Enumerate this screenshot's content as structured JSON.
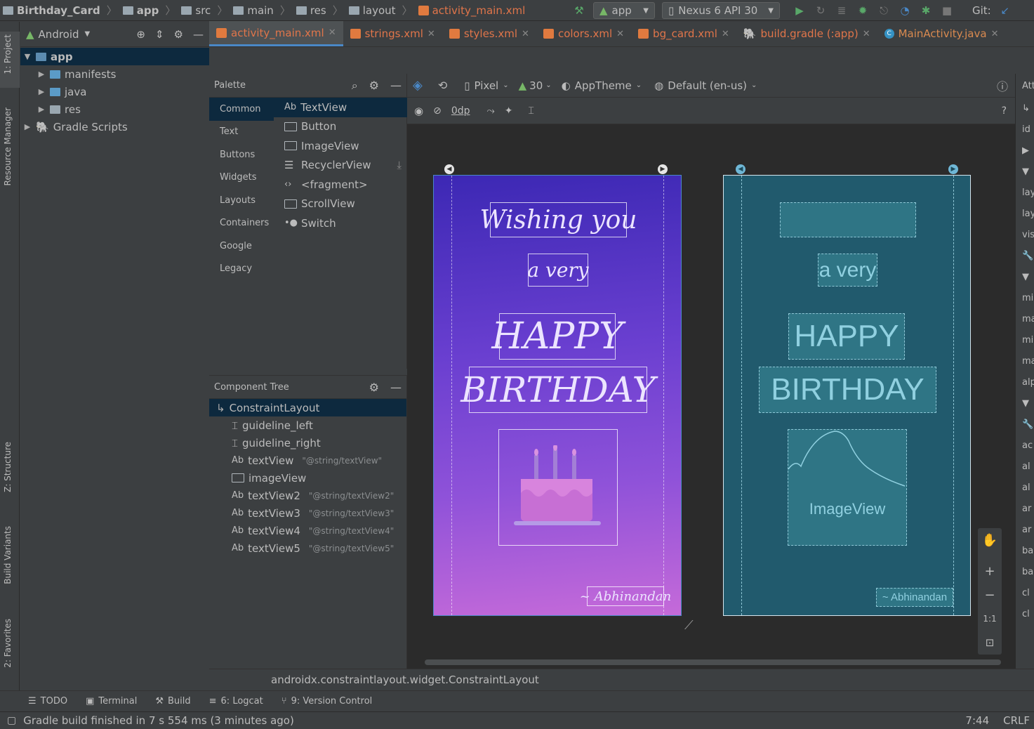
{
  "nav": {
    "crumbs": [
      "Birthday_Card",
      "app",
      "src",
      "main",
      "res",
      "layout",
      "activity_main.xml"
    ],
    "run_config": "app",
    "device": "Nexus 6 API 30",
    "git_label": "Git:"
  },
  "side_tabs": {
    "project": "1: Project",
    "resource_manager": "Resource Manager",
    "structure": "Z: Structure",
    "build_variants": "Build Variants",
    "favorites": "2: Favorites"
  },
  "project": {
    "view_mode": "Android",
    "tree": [
      {
        "label": "app",
        "level": 0,
        "selected": true,
        "expanded": true
      },
      {
        "label": "manifests",
        "level": 1
      },
      {
        "label": "java",
        "level": 1
      },
      {
        "label": "res",
        "level": 1
      },
      {
        "label": "Gradle Scripts",
        "level": 0
      }
    ]
  },
  "tabs": [
    "activity_main.xml",
    "strings.xml",
    "styles.xml",
    "colors.xml",
    "bg_card.xml",
    "build.gradle (:app)",
    "MainActivity.java"
  ],
  "palette": {
    "title": "Palette",
    "categories": [
      "Common",
      "Text",
      "Buttons",
      "Widgets",
      "Layouts",
      "Containers",
      "Google",
      "Legacy"
    ],
    "widgets": [
      "TextView",
      "Button",
      "ImageView",
      "RecyclerView",
      "<fragment>",
      "ScrollView",
      "Switch"
    ],
    "textview_prefix": "Ab"
  },
  "component_tree": {
    "title": "Component Tree",
    "items": [
      {
        "name": "ConstraintLayout",
        "ref": ""
      },
      {
        "name": "guideline_left",
        "ref": ""
      },
      {
        "name": "guideline_right",
        "ref": ""
      },
      {
        "name": "textView",
        "ref": "\"@string/textView\""
      },
      {
        "name": "imageView",
        "ref": ""
      },
      {
        "name": "textView2",
        "ref": "\"@string/textView2\""
      },
      {
        "name": "textView3",
        "ref": "\"@string/textView3\""
      },
      {
        "name": "textView4",
        "ref": "\"@string/textView4\""
      },
      {
        "name": "textView5",
        "ref": "\"@string/textView5\""
      }
    ]
  },
  "design_toolbar": {
    "device": "Pixel",
    "api": "30",
    "theme": "AppTheme",
    "locale": "Default (en-us)",
    "margin": "0dp"
  },
  "design": {
    "line1": "Wishing you",
    "line2": "a very",
    "line3": "HAPPY",
    "line4": "BIRTHDAY",
    "signature": "~ Abhinandan",
    "blueprint_image_label": "ImageView"
  },
  "attributes": {
    "header": "Att",
    "rows": [
      "id",
      "lay",
      "lay",
      "vis",
      "mi",
      "ma",
      "mi",
      "ma",
      "alp",
      "ac",
      "al",
      "al",
      "ar",
      "ar",
      "ba",
      "ba",
      "cl",
      "cl"
    ]
  },
  "zoom": {
    "one_to_one": "1:1"
  },
  "status_path": "androidx.constraintlayout.widget.ConstraintLayout",
  "tool_windows": [
    "TODO",
    "Terminal",
    "Build",
    "6: Logcat",
    "9: Version Control"
  ],
  "statusbar": {
    "message": "Gradle build finished in 7 s 554 ms (3 minutes ago)",
    "position": "7:44",
    "line_sep": "CRLF"
  },
  "colors": {
    "accent": "#4a88c7",
    "xml_tab": "#e0754a",
    "selection": "#0d293e",
    "blueprint": "#215a6d"
  }
}
